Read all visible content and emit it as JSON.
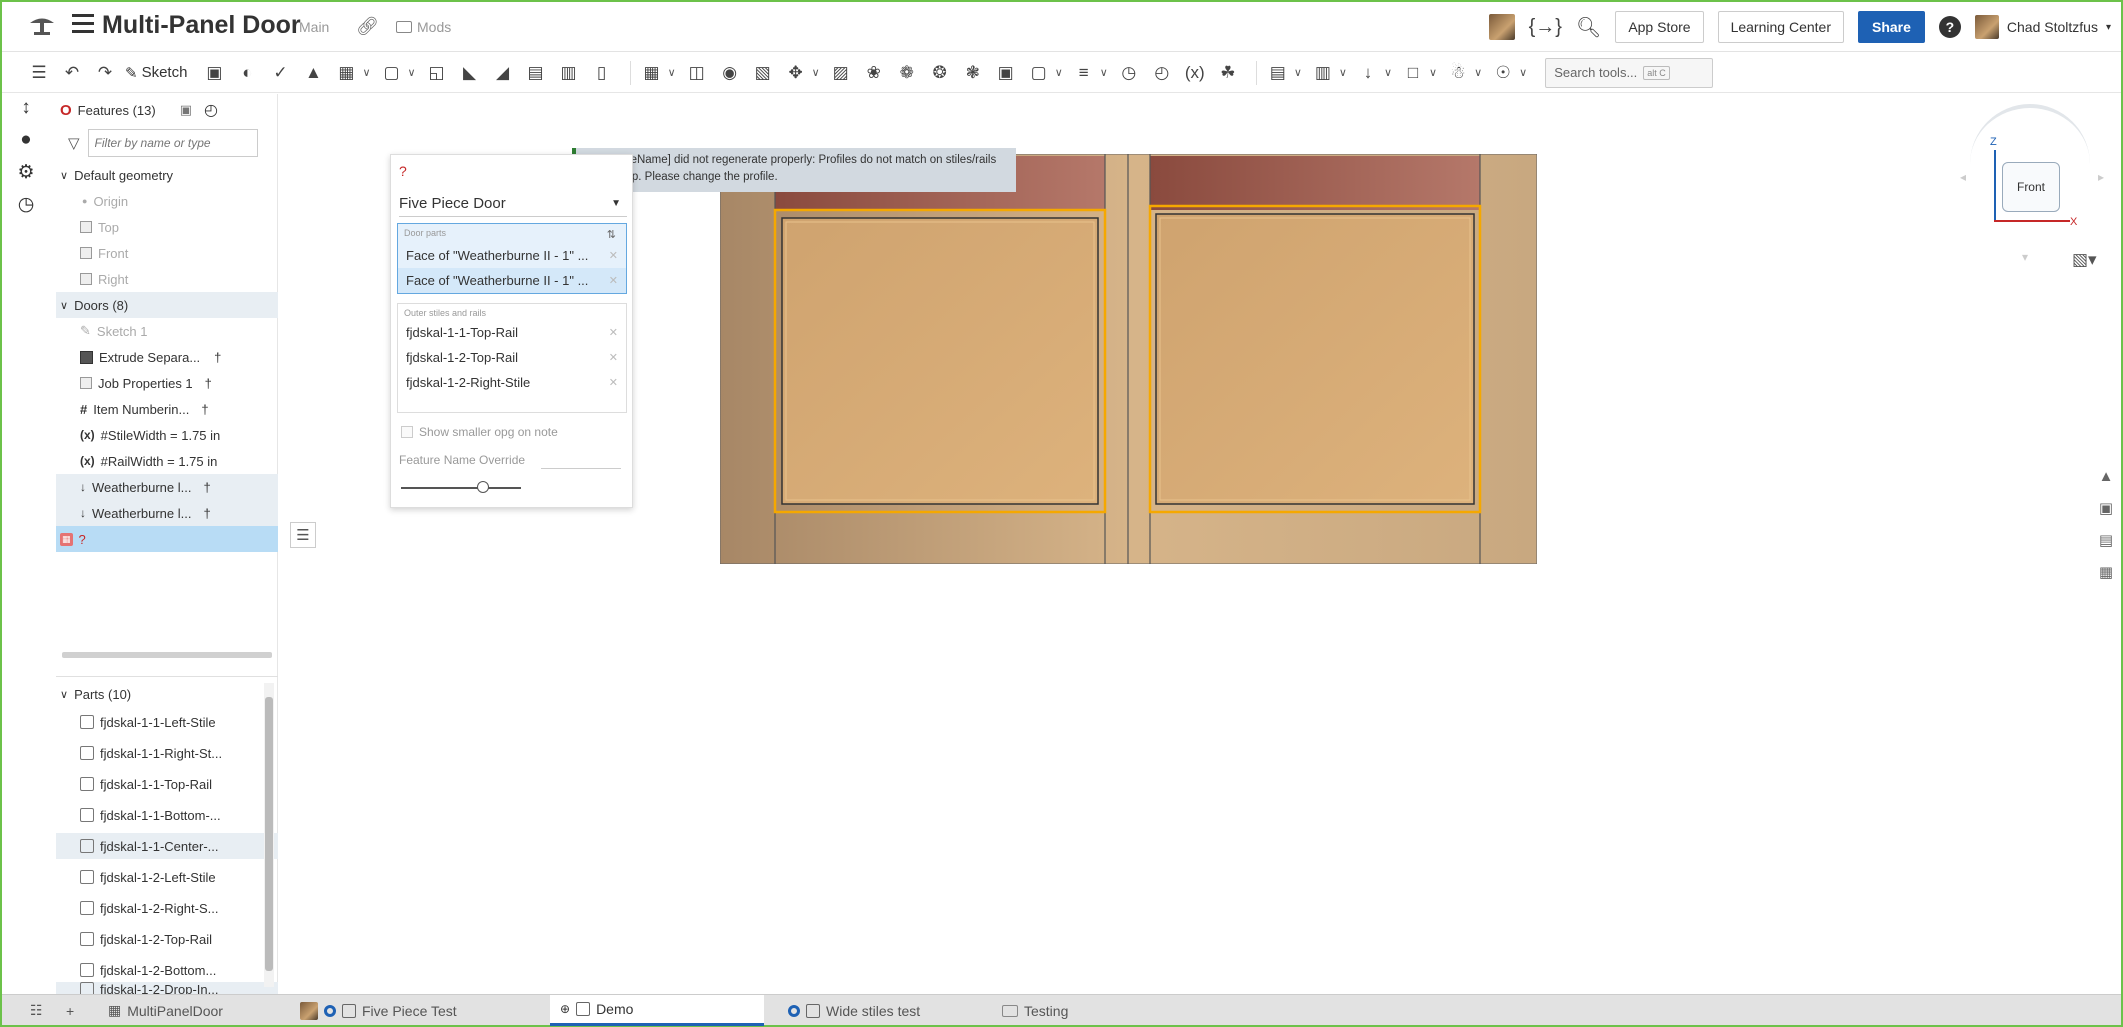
{
  "header": {
    "title": "Multi-Panel Door",
    "branch": "Main",
    "folder": "Mods",
    "app_store": "App Store",
    "learning_center": "Learning Center",
    "share": "Share",
    "user_name": "Chad Stoltzfus"
  },
  "toolbar": {
    "sketch_label": "Sketch",
    "search_placeholder": "Search tools...",
    "search_shortcut": "alt C"
  },
  "features": {
    "header_label": "Features (13)",
    "filter_placeholder": "Filter by name or type",
    "default_geometry": "Default geometry",
    "origin": "Origin",
    "top": "Top",
    "front": "Front",
    "right": "Right",
    "doors_folder": "Doors (8)",
    "sketch1": "Sketch 1",
    "extrude": "Extrude Separa...",
    "job_props": "Job Properties 1",
    "item_numbering": "Item Numberin...",
    "stile_width": "#StileWidth = 1.75 in",
    "rail_width": "#RailWidth = 1.75 in",
    "weatherburne1": "Weatherburne l...",
    "weatherburne2": "Weatherburne l...",
    "error_feature": "?"
  },
  "parts": {
    "header": "Parts (10)",
    "items": [
      "fjdskal-1-1-Left-Stile",
      "fjdskal-1-1-Right-St...",
      "fjdskal-1-1-Top-Rail",
      "fjdskal-1-1-Bottom-...",
      "fjdskal-1-1-Center-...",
      "fjdskal-1-2-Left-Stile",
      "fjdskal-1-2-Right-S...",
      "fjdskal-1-2-Top-Rail",
      "fjdskal-1-2-Bottom...",
      "fjdskal-1-2-Drop-In..."
    ]
  },
  "dialog": {
    "feature_name": "?",
    "door_type": "Five Piece Door",
    "door_parts_title": "Door parts",
    "door_parts": [
      "Face of \"Weatherburne II - 1\" ...",
      "Face of \"Weatherburne II - 1\" ..."
    ],
    "outer_title": "Outer stiles and rails",
    "outer_items": [
      "fjdskal-1-1-Top-Rail",
      "fjdskal-1-2-Top-Rail",
      "fjdskal-1-2-Right-Stile"
    ],
    "show_smaller": "Show smaller opg on note",
    "name_override": "Feature Name Override"
  },
  "error_tooltip": "? [#featureName] did not regenerate properly: Profiles do not match on stiles/rails that line up. Please change the profile.",
  "viewcube": {
    "face": "Front",
    "z": "Z",
    "x": "X"
  },
  "tabs": {
    "t1": "MultiPanelDoor",
    "t2": "Five Piece Test",
    "t3": "Demo",
    "t4": "Wide stiles test",
    "t5": "Testing"
  },
  "colors": {
    "share_blue": "#1e61b4",
    "error_red": "#c62828",
    "frame_green": "#6cc24a",
    "selection_orange": "#f5a800"
  }
}
